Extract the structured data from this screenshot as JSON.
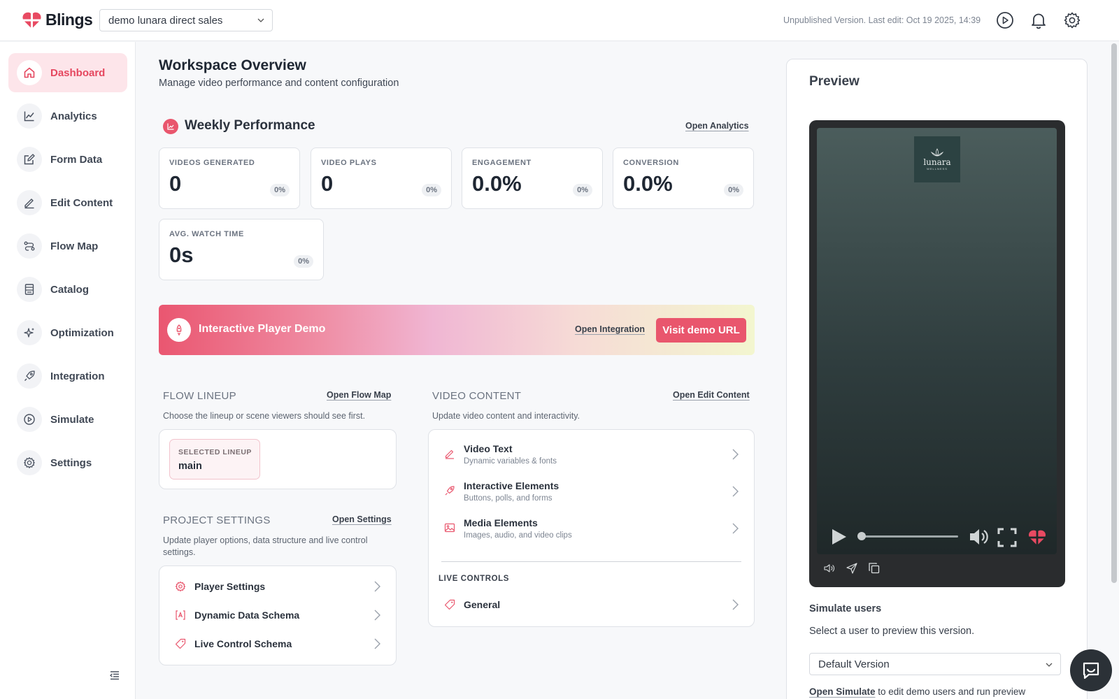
{
  "app": {
    "brand": "Blings"
  },
  "header": {
    "workspace": "demo lunara direct sales",
    "status": "Unpublished Version. Last edit: Oct 19 2025, 14:39"
  },
  "sidebar": {
    "items": [
      {
        "label": "Dashboard",
        "icon": "home-icon",
        "active": true
      },
      {
        "label": "Analytics",
        "icon": "chart-line-icon"
      },
      {
        "label": "Form Data",
        "icon": "form-edit-icon"
      },
      {
        "label": "Edit Content",
        "icon": "pencil-icon"
      },
      {
        "label": "Flow Map",
        "icon": "flow-icon"
      },
      {
        "label": "Catalog",
        "icon": "catalog-icon"
      },
      {
        "label": "Optimization",
        "icon": "sparkle-icon"
      },
      {
        "label": "Integration",
        "icon": "rocket-icon"
      },
      {
        "label": "Simulate",
        "icon": "play-circle-icon"
      },
      {
        "label": "Settings",
        "icon": "gear-icon"
      }
    ]
  },
  "main": {
    "title": "Workspace Overview",
    "subtitle": "Manage video performance and content configuration",
    "weekly": {
      "title": "Weekly Performance",
      "link": "Open Analytics",
      "stats": [
        {
          "label": "VIDEOS GENERATED",
          "value": "0",
          "delta": "0%"
        },
        {
          "label": "VIDEO PLAYS",
          "value": "0",
          "delta": "0%"
        },
        {
          "label": "ENGAGEMENT",
          "value": "0.0%",
          "delta": "0%"
        },
        {
          "label": "CONVERSION",
          "value": "0.0%",
          "delta": "0%"
        },
        {
          "label": "AVG. WATCH TIME",
          "value": "0s",
          "delta": "0%"
        }
      ]
    },
    "demo": {
      "title": "Interactive Player Demo",
      "link": "Open Integration",
      "button": "Visit demo URL"
    },
    "flow": {
      "title": "FLOW LINEUP",
      "link": "Open Flow Map",
      "desc": "Choose the lineup or scene viewers should see first.",
      "selected_label": "SELECTED LINEUP",
      "selected_value": "main"
    },
    "project": {
      "title": "PROJECT SETTINGS",
      "link": "Open Settings",
      "desc": "Update player options, data structure and live control settings.",
      "items": [
        "Player Settings",
        "Dynamic Data Schema",
        "Live Control Schema"
      ]
    },
    "video_content": {
      "title": "VIDEO CONTENT",
      "link": "Open Edit Content",
      "desc": "Update video content and interactivity.",
      "items": [
        {
          "title": "Video Text",
          "desc": "Dynamic variables & fonts"
        },
        {
          "title": "Interactive Elements",
          "desc": "Buttons, polls, and forms"
        },
        {
          "title": "Media Elements",
          "desc": "Images, audio, and video clips"
        }
      ],
      "live_label": "LIVE CONTROLS",
      "live_items": [
        "General"
      ]
    }
  },
  "preview": {
    "title": "Preview",
    "brand_name": "lunara",
    "brand_sub": "WELLNESS",
    "progress": 0,
    "simulate_title": "Simulate users",
    "simulate_desc": "Select a user to preview this version.",
    "select_value": "Default Version",
    "footer_link": "Open Simulate",
    "footer_text": " to edit demo users and run preview"
  },
  "colors": {
    "accent": "#e9566d",
    "active_bg": "#fde5ea"
  }
}
